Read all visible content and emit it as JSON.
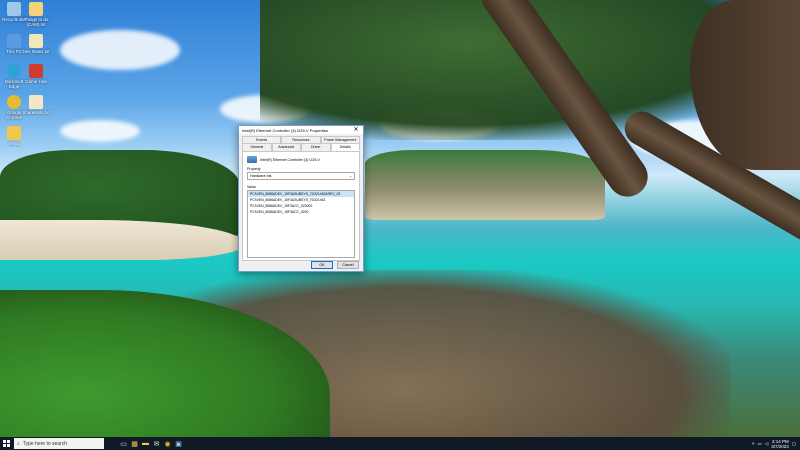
{
  "desktop": {
    "icons": [
      {
        "label": "Recycle Bin",
        "color": "#9ec7e8"
      },
      {
        "label": "Things to do (CAM).txt",
        "color": "#f4d27a"
      },
      {
        "label": "This PC",
        "color": "#5c9be0"
      },
      {
        "label": "Dev Notes.txt",
        "color": "#f1e8b8"
      },
      {
        "label": "Microsoft Edge",
        "color": "#2fa2d8"
      },
      {
        "label": "Game Hub",
        "color": "#d23b2f"
      },
      {
        "label": "Google Chrome",
        "color": "#e8b935"
      },
      {
        "label": "ShareNote.txt",
        "color": "#f3e7c5"
      },
      {
        "label": "Setup",
        "color": "#f0c850"
      }
    ]
  },
  "dialog": {
    "title": "Intel(R) Ethernet Controller (3) I225-V Properties",
    "close_glyph": "✕",
    "tabs_top": [
      "Events",
      "Resources",
      "Power Management"
    ],
    "tabs_bottom": [
      "General",
      "Advanced",
      "Driver",
      "Details"
    ],
    "active_tab": "Details",
    "device_name": "Intel(R) Ethernet Controller (3) I225-V",
    "property_label": "Property",
    "property_value": "Hardware Ids",
    "value_label": "Value",
    "values": [
      "PCI\\VEN_8086&DEV_15F3&SUBSYS_7D321462&REV_03",
      "PCI\\VEN_8086&DEV_15F3&SUBSYS_7D321462",
      "PCI\\VEN_8086&DEV_15F3&CC_020000",
      "PCI\\VEN_8086&DEV_15F3&CC_0200"
    ],
    "ok_label": "OK",
    "cancel_label": "Cancel"
  },
  "taskbar": {
    "search_placeholder": "Type here to search",
    "time": "2:14 PM",
    "date": "3/7/2023"
  }
}
